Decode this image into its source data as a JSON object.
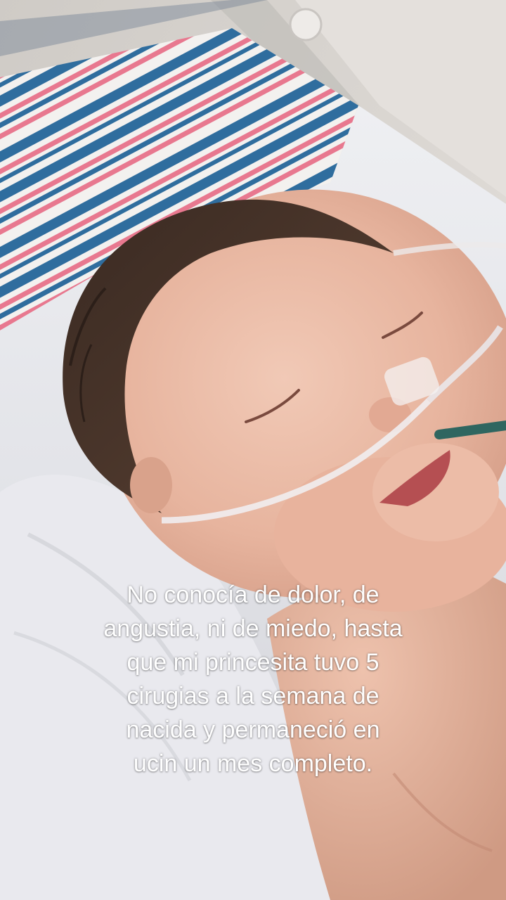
{
  "photo": {
    "subject": "sleeping-newborn-with-nasal-cannula",
    "blanket_colors": [
      "#2f6d9e",
      "#e8788f",
      "#f3f1ef"
    ]
  },
  "caption": {
    "lines": [
      "No conocía de dolor, de",
      "angustia, ni de miedo, hasta",
      "que mi princesita tuvo 5",
      "cirugias a la semana de",
      "nacida y permaneció en",
      "ucin un mes completo."
    ]
  }
}
